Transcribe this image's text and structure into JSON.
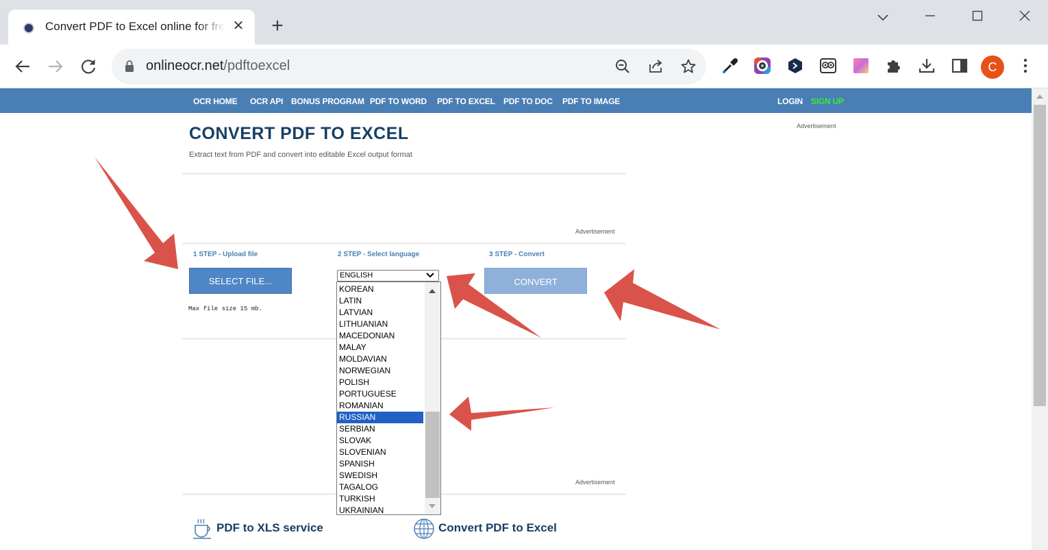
{
  "browser": {
    "tab_title": "Convert PDF to Excel online for free",
    "url_host": "onlineocr.net",
    "url_path": "/pdftoexcel",
    "avatar_initial": "C"
  },
  "nav": {
    "items": [
      "OCR HOME",
      "OCR API",
      "BONUS PROGRAM",
      "PDF TO WORD",
      "PDF TO EXCEL",
      "PDF TO DOC",
      "PDF TO IMAGE"
    ],
    "login": "LOGIN",
    "signup": "SIGN UP"
  },
  "page": {
    "title": "CONVERT PDF TO EXCEL",
    "subtitle": "Extract text from PDF and convert into editable Excel output format",
    "advertisement": "Advertisement",
    "steps": [
      "1 STEP - Upload file",
      "2 STEP - Select language",
      "3 STEP - Convert"
    ],
    "select_file_button": "SELECT FILE...",
    "convert_button": "CONVERT",
    "max_file_size": "Max file size 15 mb.",
    "language_selected": "ENGLISH",
    "language_options": [
      "KOREAN",
      "LATIN",
      "LATVIAN",
      "LITHUANIAN",
      "MACEDONIAN",
      "MALAY",
      "MOLDAVIAN",
      "NORWEGIAN",
      "POLISH",
      "PORTUGUESE",
      "ROMANIAN",
      "RUSSIAN",
      "SERBIAN",
      "SLOVAK",
      "SLOVENIAN",
      "SPANISH",
      "SWEDISH",
      "TAGALOG",
      "TURKISH",
      "UKRAINIAN"
    ],
    "highlighted_option": "RUSSIAN",
    "features": [
      "PDF to XLS service",
      "Convert PDF to Excel"
    ]
  },
  "colors": {
    "nav_bg": "#4a7fb5",
    "signup": "#33ee33",
    "title": "#173f63",
    "annotation_arrow": "#d9534a"
  },
  "icons": [
    "back-icon",
    "forward-icon",
    "reload-icon",
    "lock-icon",
    "zoom-out-icon",
    "share-icon",
    "star-icon",
    "eyedropper-icon",
    "camera-extension-icon",
    "hex-extension-icon",
    "owl-extension-icon",
    "gradient-extension-icon",
    "puzzle-icon",
    "download-icon",
    "side-panel-icon",
    "menu-icon",
    "coffee-cup-icon",
    "globe-icon"
  ]
}
